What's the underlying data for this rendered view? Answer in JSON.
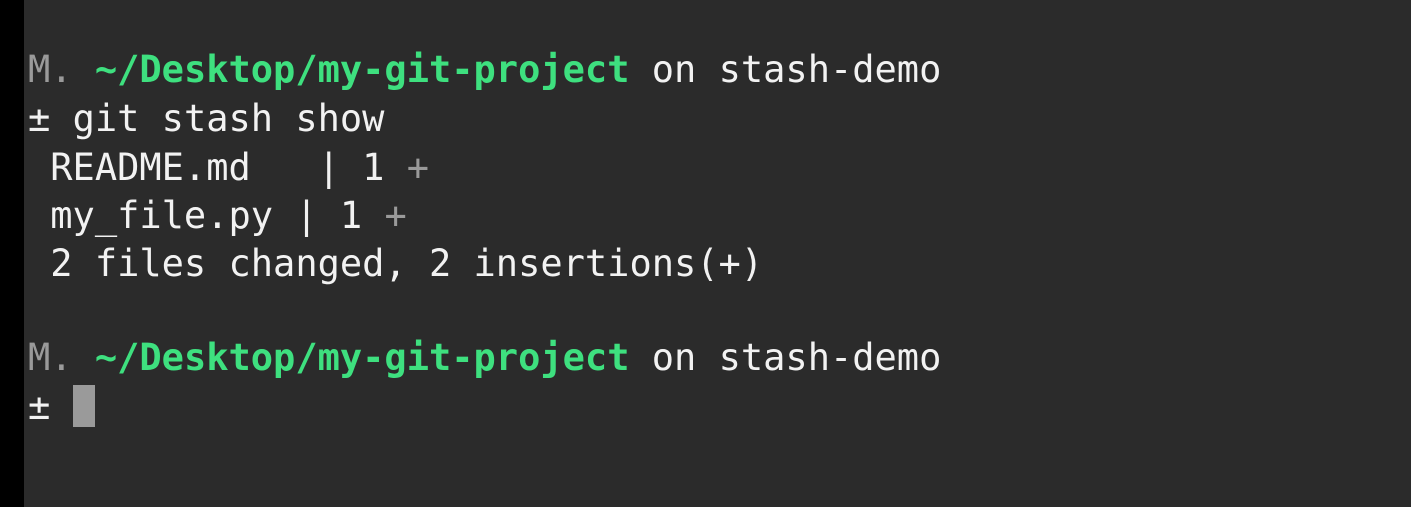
{
  "prompt1": {
    "user": "M.",
    "path": "~/Desktop/my-git-project",
    "on": "on",
    "branch": "stash-demo"
  },
  "command": {
    "symbol": "±",
    "text": "git stash show"
  },
  "output": {
    "files": [
      {
        "name": "README.md",
        "pad": "  ",
        "sep": "|",
        "count": "1",
        "graph": "+"
      },
      {
        "name": "my_file.py",
        "pad": " ",
        "sep": "|",
        "count": "1",
        "graph": "+"
      }
    ],
    "summary": "2 files changed, 2 insertions(+)"
  },
  "prompt2": {
    "user": "M.",
    "path": "~/Desktop/my-git-project",
    "on": "on",
    "branch": "stash-demo",
    "symbol": "±"
  },
  "colors": {
    "background": "#2b2b2b",
    "path": "#3ee07f",
    "dim": "#9a9a9a",
    "text": "#f2f2f2"
  }
}
